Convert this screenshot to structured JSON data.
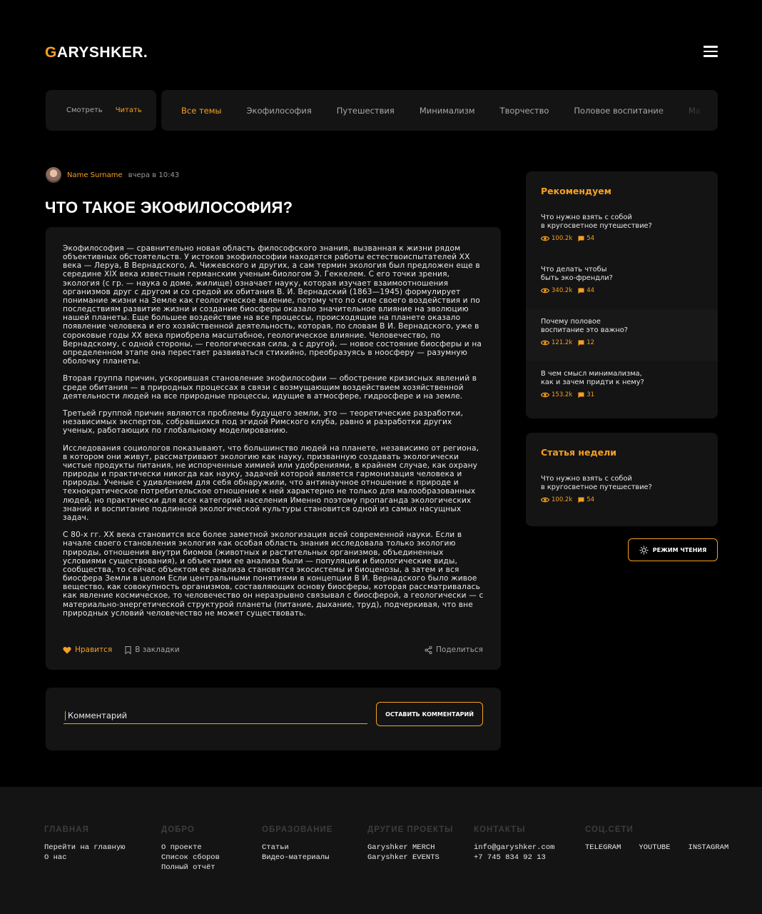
{
  "header": {
    "logo_first": "G",
    "logo_rest": "ARYSHKER."
  },
  "mode_switch": {
    "watch": "Смотреть",
    "read": "Читать"
  },
  "topics": [
    "Все темы",
    "Экофилософия",
    "Путешествия",
    "Минимализм",
    "Творчество",
    "Половое воспитание",
    "Ма"
  ],
  "article": {
    "author": "Name Surname",
    "time": "вчера в 10:43",
    "title": "ЧТО ТАКОЕ ЭКОФИЛОСОФИЯ?",
    "paragraphs": [
      "Экофилософия — сравнительно новая область философского знания, вызванная к жизни рядом объективных обстоятельств. У истоков экофилософии находятся работы естествоиспытателей XX века — Леруа, В Вернадского, А. Чижевского и других, а сам термин экология был предложен еще в середине XIX века известным германским ученым-биологом Э. Геккелем. С его точки зрения, экология (с гр. — наука о доме, жилище) означает науку, которая изучает взаимоотношения организмов друг с другом и со средой их обитания В. И. Вернадский (1863—1945) формулирует понимание жизни на Земле как геологическое явление, потому что по силе своего воздействия и по последствиям развитие жизни и создание биосферы оказало значительное влияние на эволюцию нашей планеты. Еще большее воздействие на все процессы, происходящие на планете оказало появление человека и его хозяйственной деятельность, которая, по словам В И. Вернадского, уже в сороковые годы XX века приобрела масштабное, геологическое влияние. Человечество, по Вернадскому, с одной стороны, — геологическая сила, а с другой, — новое состояние биосферы и на определенном этапе она перестает развиваться стихийно, преобразуясь в ноосферу — разумную оболочку планеты.",
      "Вторая группа причин, ускорившая становление экофилософии — обострение кризисных явлений в среде обитания — в природных процессах в связи с возмущающим воздействием хозяйственной деятельности людей на все природные процессы, идущие в атмосфере, гидросфере и на земле.",
      "Третьей группой причин являются проблемы будущего земли, это — теоретические разработки, независимых экспертов, собравшихся под эгидой Римского клуба, равно и разработки других ученых, работающих по глобальному моделированию.",
      "Исследования социологов показывают, что большинство людей на планете, независимо от региона, в котором они живут, рассматривают экологию как науку, призванную создавать экологически чистые продукты питания, не испорченные химией или удобрениями, в крайнем случае, как охрану природы и практически никогда как науку, задачей которой является гармонизация человека и природы. Ученые с удивлением для себя обнаружили, что антинаучное отношение к природе и технократическое потребительское отношение к ней характерно не только для малообразованных людей, но практически для всех категорий населения Именно поэтому пропаганда экологических знаний и воспитание подлинной экологической культуры становится одной из самых насущных задач.",
      "С 80-х гг. XX века становится все более заметной экологизация всей современной науки. Если в начале своего становления экология как особая область знания исследовала только экологию природы, отношения внутри биомов (животных и растительных организмов, объединенных условиями существования), и объектами ее анализа были — популяции и биологические виды, сообщества, то сейчас объектом ее анализа становятся экосистемы и биоценозы, а затем и вся биосфера Земли в целом Если центральными понятиями в концепции В И. Вернадского было живое вещество, как совокупность организмов, составляющих основу биосферы, которая рассматривалась как явление космическое, то человечество он неразрывно связывал с биосферой, а геологически — с материально-энергетической структурой планеты (питание, дыхание, труд), подчеркивая, что вне природных условий человечество не может существовать."
    ],
    "like": "Нравится",
    "bookmark": "В закладки",
    "share": "Поделиться"
  },
  "comment": {
    "placeholder": "Комментарий",
    "submit": "ОСТАВИТЬ КОММЕНТАРИЙ"
  },
  "recommended": {
    "title": "Рекомендуем",
    "items": [
      {
        "question": "Что нужно взять с собой\nв кругосветное путешествие?",
        "views": "100.2k",
        "comments": "54"
      },
      {
        "question": "Что делать чтобы\nбыть эко-френдли?",
        "views": "340.2k",
        "comments": "44"
      },
      {
        "question": "Почему половое\nвоспитание это важно?",
        "views": "121.2k",
        "comments": "12"
      },
      {
        "question": "В чем смысл минимализма,\nкак и зачем придти к нему?",
        "views": "153.2k",
        "comments": "31"
      }
    ]
  },
  "week_article": {
    "title": "Статья недели",
    "question": "Что нужно взять с собой\nв кругосветное путешествие?",
    "views": "100.2k",
    "comments": "54"
  },
  "reader_mode": "РЕЖИМ ЧТЕНИЯ",
  "footer": {
    "main": {
      "title": "ГЛАВНАЯ",
      "links": [
        "Перейти на главную",
        "О нас"
      ]
    },
    "good": {
      "title": "ДОБРО",
      "links": [
        "О проекте",
        "Список сборов",
        "Полный отчёт"
      ]
    },
    "edu": {
      "title": "ОБРАЗОВАНИЕ",
      "links": [
        "Статьи",
        "Видео-материалы"
      ]
    },
    "projects": {
      "title": "ДРУГИЕ ПРОЕКТЫ",
      "links": [
        "Garyshker MERCH",
        "Garyshker EVENTS"
      ]
    },
    "contacts": {
      "title": "КОНТАКТЫ",
      "links": [
        "info@garyshker.com",
        "+7 745 834 92 13"
      ]
    },
    "social": {
      "title": "СОЦ.СЕТИ",
      "links": [
        "TELEGRAM",
        "YOUTUBE",
        "INSTAGRAM"
      ]
    }
  },
  "colors": {
    "accent": "#f7a022",
    "panel": "#141414",
    "background": "#000000"
  }
}
